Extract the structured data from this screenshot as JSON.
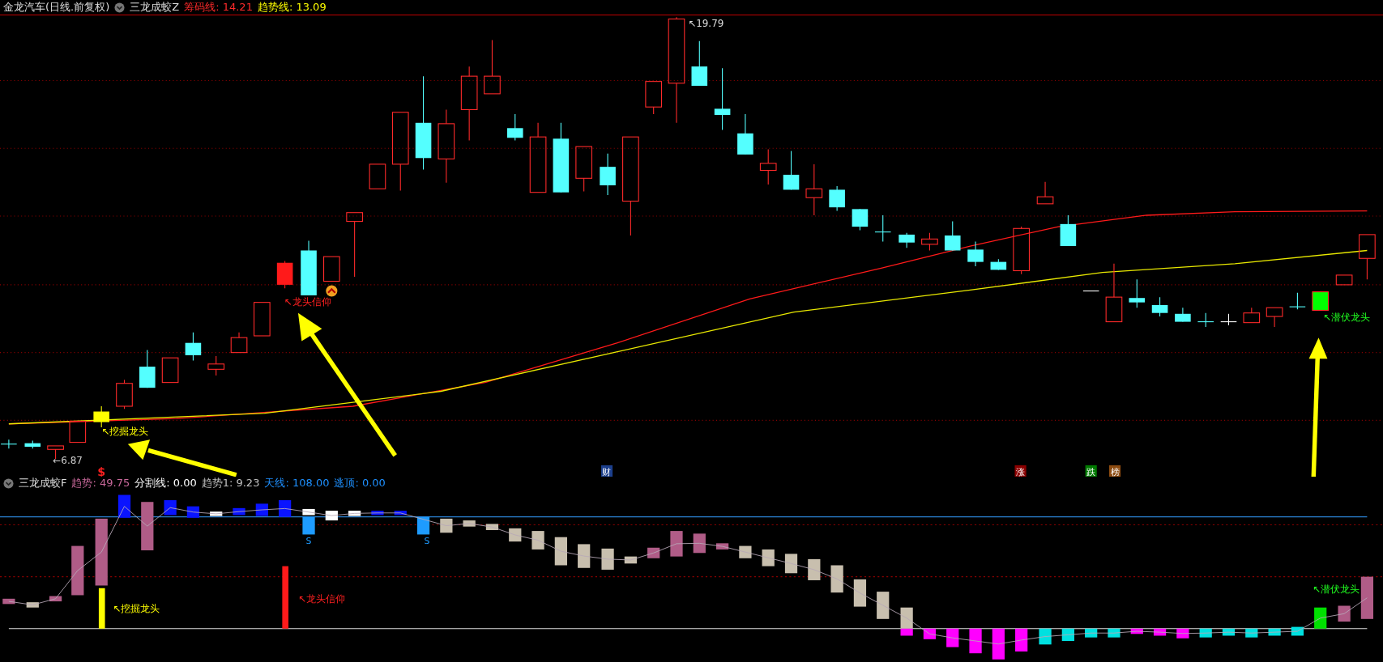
{
  "main_chart": {
    "security": "金龙汽车(日线.前复权)",
    "indicator": "三龙成蛟Z",
    "readouts": [
      {
        "label": "筹码线: ",
        "value": "14.21",
        "color": "#ff2a2a"
      },
      {
        "label": "趋势线: ",
        "value": "13.09",
        "color": "#ffff00"
      }
    ],
    "price_labels": [
      {
        "kind": "high",
        "text": "↖19.79"
      },
      {
        "kind": "low",
        "text": "←6.87"
      }
    ],
    "signals": [
      {
        "text": "↖挖掘龙头",
        "color": "#ffff00"
      },
      {
        "text": "↖龙头信仰",
        "color": "#ff2020"
      },
      {
        "text": "↖潜伏龙头",
        "color": "#20ff20"
      }
    ],
    "markers": [
      {
        "text": "$",
        "color": "#ff2020"
      }
    ],
    "events": [
      {
        "text": "财",
        "color": "#1c3f8c"
      },
      {
        "text": "涨",
        "color": "#8b0000"
      },
      {
        "text": "跌",
        "color": "#007a00"
      },
      {
        "text": "榜",
        "color": "#8b4a10"
      }
    ]
  },
  "sub_chart": {
    "indicator": "三龙成蛟F",
    "readouts": [
      {
        "label": "趋势: ",
        "value": "49.75",
        "color": "#c8689a"
      },
      {
        "label": "分割线: ",
        "value": "0.00",
        "color": "#ffffff"
      },
      {
        "label": "趋势1: ",
        "value": "9.23",
        "color": "#c0c0c0"
      },
      {
        "label": "天线: ",
        "value": "108.00",
        "color": "#1e90ff"
      },
      {
        "label": "逃顶: ",
        "value": "0.00",
        "color": "#1e90ff"
      }
    ],
    "sell_marks": [
      {
        "text": "S"
      },
      {
        "text": "S"
      }
    ],
    "signals": [
      {
        "text": "↖挖掘龙头",
        "color": "#ffff00"
      },
      {
        "text": "↖龙头信仰",
        "color": "#ff2020"
      },
      {
        "text": "↖潜伏龙头",
        "color": "#20ff20"
      }
    ]
  }
}
